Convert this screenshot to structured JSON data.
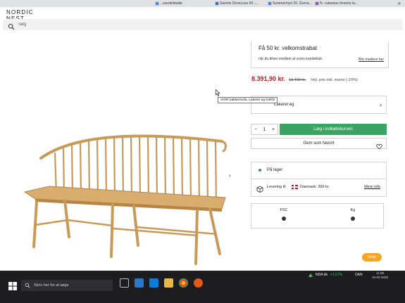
{
  "browser": {
    "tabs": [
      {
        "label": "...ssedelstudie",
        "color": "#4285f4"
      },
      {
        "label": "Garmin DriveLuxe 50 -...",
        "color": "#2d6cdf"
      },
      {
        "label": "Sommerhyst 20, Grena...",
        "color": "#4285f4"
      },
      {
        "label": "N. cutaneus femoris la...",
        "color": "#7e57c2"
      }
    ]
  },
  "header": {
    "logo_line1": "NORDIC",
    "logo_line2": "NEST",
    "search_placeholder": "Søg"
  },
  "welcome": {
    "title": "Få 50 kr. velkomstrabat",
    "subtitle": "når du bliver medlem af vores kundeklub",
    "link": "Bliv medlem her"
  },
  "pricing": {
    "price": "8.391,90 kr.",
    "old_price": "10.490 kr.",
    "note": "Vejl. pris inkl. moms  (-20%)"
  },
  "tooltip": "VIOR køkkensofa, Lakeret eg NJRD",
  "variant": {
    "label": "Lakeret eg"
  },
  "cart": {
    "minus": "−",
    "quantity": "1",
    "plus": "+",
    "add_label": "Læg i indkøbskurven"
  },
  "favorite": {
    "label": "Gem som favorit"
  },
  "stock": {
    "status": "På lager",
    "delivery_prefix": "Levering til",
    "delivery_price": "Danmark: 399 kr.",
    "more": "Mere info"
  },
  "certs": [
    {
      "label": "FSC"
    },
    {
      "label": "Eg"
    }
  ],
  "help": "Help",
  "gallery_next": "›",
  "taskbar": {
    "search_placeholder": "Skriv her for at søge",
    "ticker": "NDA dk",
    "ticker_change": "+1,57%",
    "lang": "DAN",
    "time": "11:08",
    "date": "16-02-2026"
  },
  "colors": {
    "price": "#b31d22",
    "cta": "#3aa563",
    "in_stock": "#2e9b50",
    "help": "#f6a623"
  }
}
